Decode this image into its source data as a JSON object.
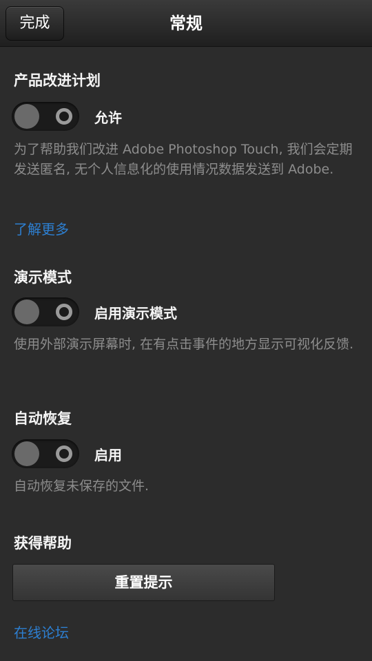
{
  "header": {
    "title": "常规",
    "done_label": "完成"
  },
  "sections": {
    "improvement": {
      "title": "产品改进计划",
      "toggle_label": "允许",
      "toggle_on": false,
      "description": "为了帮助我们改进 Adobe Photoshop Touch, 我们会定期发送匿名, 无个人信息化的使用情况数据发送到 Adobe.",
      "link": "了解更多"
    },
    "demo": {
      "title": "演示模式",
      "toggle_label": "启用演示模式",
      "toggle_on": false,
      "description": "使用外部演示屏幕时, 在有点击事件的地方显示可视化反馈."
    },
    "autorecover": {
      "title": "自动恢复",
      "toggle_label": "启用",
      "toggle_on": false,
      "description": "自动恢复未保存的文件."
    },
    "help": {
      "title": "获得帮助",
      "reset_button": "重置提示",
      "forum_link": "在线论坛"
    }
  },
  "colors": {
    "background": "#2c2c2c",
    "link": "#2d7fd1",
    "description": "#8d8d8d"
  }
}
